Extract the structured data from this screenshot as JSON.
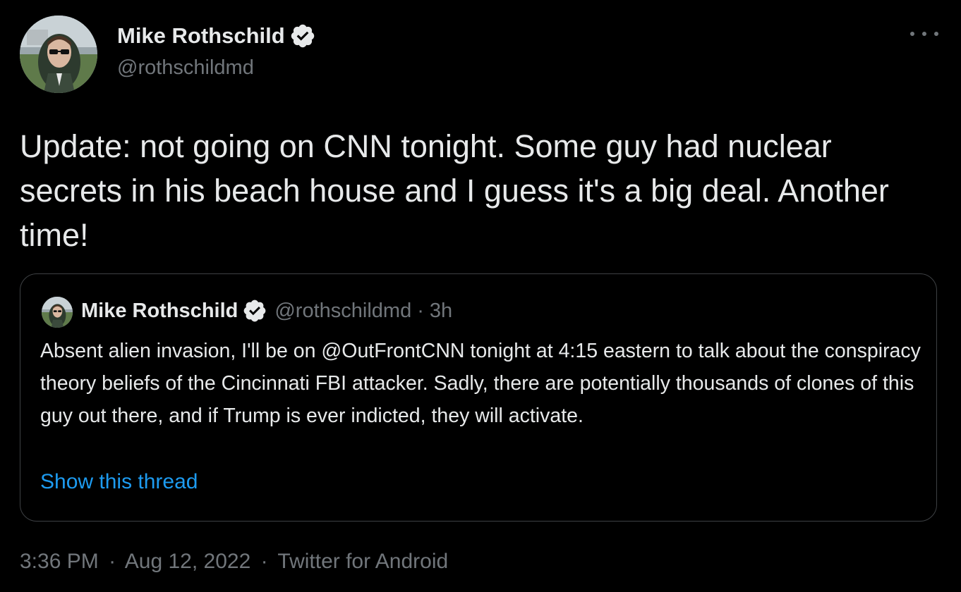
{
  "author": {
    "name": "Mike Rothschild",
    "handle": "@rothschildmd",
    "verified": true
  },
  "tweet": {
    "text": "Update: not going on CNN tonight. Some guy had nuclear secrets in his beach house and I guess it's a big deal. Another time!"
  },
  "quoted_tweet": {
    "name": "Mike Rothschild",
    "handle": "@rothschildmd",
    "separator": "·",
    "time": "3h",
    "text": "Absent alien invasion, I'll be on @OutFrontCNN tonight at 4:15 eastern to talk about the conspiracy theory beliefs of the Cincinnati FBI attacker. Sadly, there are potentially thousands of clones of this guy out there, and if Trump is ever indicted, they will activate.",
    "show_thread_label": "Show this thread"
  },
  "footer": {
    "time": "3:36 PM",
    "separator": "·",
    "date": "Aug 12, 2022",
    "source": "Twitter for Android"
  },
  "icons": {
    "verified": "verified-badge-icon",
    "more": "more-options-icon"
  },
  "colors": {
    "background": "#000000",
    "text": "#e7e9ea",
    "muted": "#71767b",
    "link": "#1d9bf0",
    "border": "#3e4144"
  }
}
